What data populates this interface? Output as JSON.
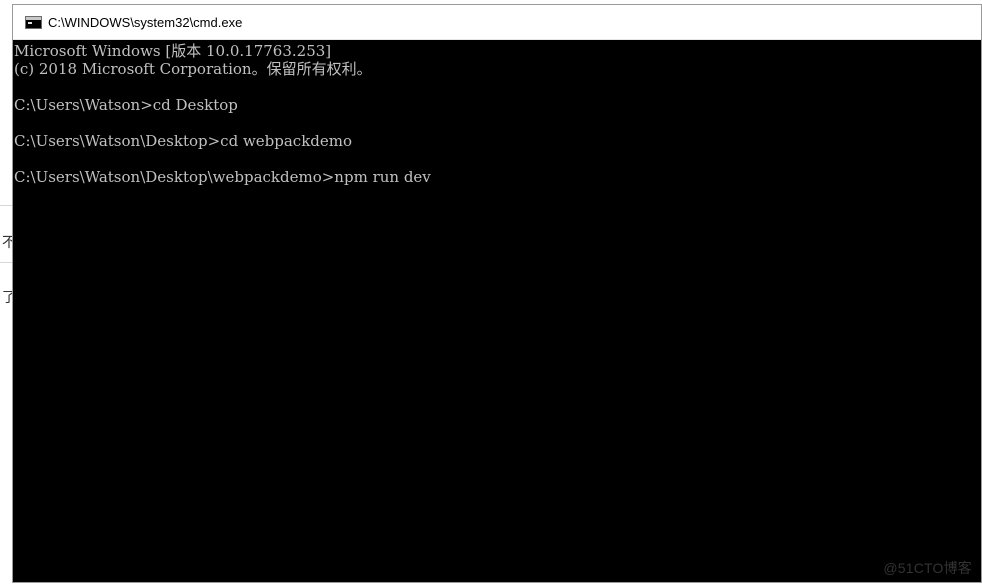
{
  "window": {
    "title": "C:\\WINDOWS\\system32\\cmd.exe",
    "icon": "cmd-icon"
  },
  "console": {
    "lines": [
      "Microsoft Windows [版本 10.0.17763.253]",
      "(c) 2018 Microsoft Corporation。保留所有权利。",
      "",
      "C:\\Users\\Watson>cd Desktop",
      "",
      "C:\\Users\\Watson\\Desktop>cd webpackdemo",
      "",
      "C:\\Users\\Watson\\Desktop\\webpackdemo>npm run dev"
    ]
  },
  "background": {
    "glyph_1": "不",
    "glyph_2": "了"
  },
  "watermark": "@51CTO博客",
  "colors": {
    "console_bg": "#000000",
    "console_text": "#c0c0c0",
    "title_bar_bg": "#ffffff"
  }
}
